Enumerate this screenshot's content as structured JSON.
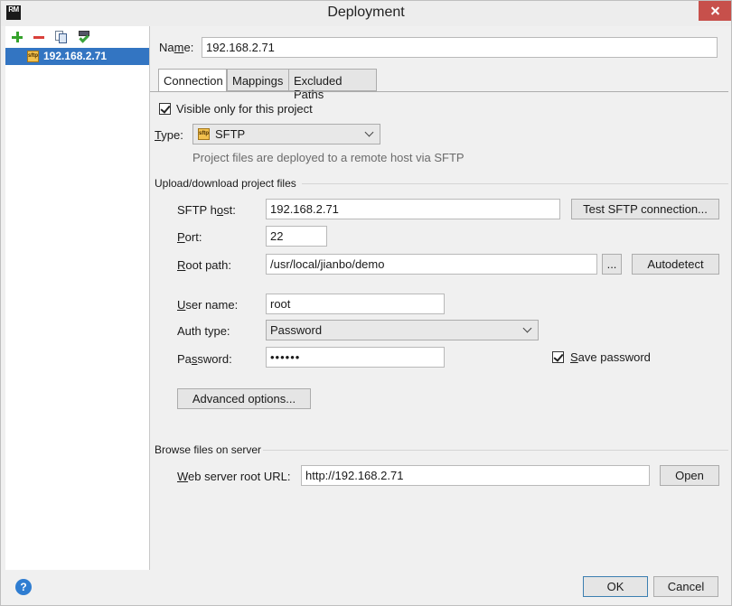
{
  "window": {
    "title": "Deployment",
    "app_icon": "RM"
  },
  "toolbar": {
    "add_icon": "plus-icon",
    "remove_icon": "minus-icon",
    "copy_icon": "copy-icon",
    "default_icon": "use-as-default-icon"
  },
  "servers": [
    {
      "name": "192.168.2.71",
      "icon": "sftp-icon"
    }
  ],
  "name_field": {
    "label": "Name:",
    "value": "192.168.2.71"
  },
  "tabs": [
    {
      "label": "Connection",
      "active": true
    },
    {
      "label": "Mappings",
      "active": false
    },
    {
      "label": "Excluded Paths",
      "active": false
    }
  ],
  "connection": {
    "visible_only": {
      "label": "Visible only for this project",
      "checked": true
    },
    "type": {
      "label": "Type:",
      "icon_text": "sftp",
      "value": "SFTP",
      "hint": "Project files are deployed to a remote host via SFTP"
    },
    "upload_section": "Upload/download project files",
    "sftp_host": {
      "label": "SFTP host:",
      "value": "192.168.2.71"
    },
    "test_button": "Test SFTP connection...",
    "port": {
      "label": "Port:",
      "value": "22"
    },
    "root_path": {
      "label": "Root path:",
      "value": "/usr/local/jianbo/demo"
    },
    "browse_button": "...",
    "autodetect_button": "Autodetect",
    "user_name": {
      "label": "User name:",
      "value": "root"
    },
    "auth_type": {
      "label": "Auth type:",
      "value": "Password"
    },
    "password": {
      "label": "Password:",
      "value": "••••••"
    },
    "save_password": {
      "label": "Save password",
      "checked": true
    },
    "advanced_button": "Advanced options...",
    "browse_section": "Browse files on server",
    "web_root": {
      "label": "Web server root URL:",
      "value": "http://192.168.2.71"
    },
    "open_button": "Open"
  },
  "footer": {
    "help": "?",
    "ok": "OK",
    "cancel": "Cancel"
  }
}
